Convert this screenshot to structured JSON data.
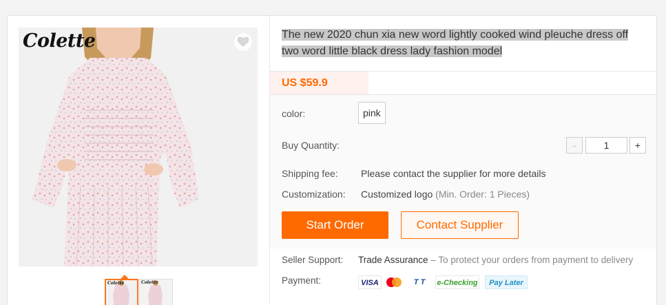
{
  "gallery": {
    "brand": "Colette",
    "thumb_brand": "Colette"
  },
  "product": {
    "title": "The new 2020 chun xia new word lightly cooked wind pleuche dress off two word little black dress lady fashion model",
    "price": "US $59.9"
  },
  "attributes": {
    "color_label": "color:",
    "color_value": "pink",
    "quantity_label": "Buy Quantity:",
    "quantity_value": "1",
    "minus": "-",
    "plus": "+",
    "shipping_label": "Shipping fee:",
    "shipping_value": "Please contact the supplier for more details",
    "customization_label": "Customization:",
    "customization_value": "Customized logo",
    "customization_note": "(Min. Order: 1 Pieces)"
  },
  "actions": {
    "start_order": "Start Order",
    "contact_supplier": "Contact Supplier"
  },
  "support": {
    "seller_support_label": "Seller Support:",
    "trade_assurance": "Trade Assurance",
    "trade_assurance_note": "– To protect your orders from payment to delivery",
    "payment_label": "Payment:",
    "methods": {
      "visa": "VISA",
      "tt": "T T",
      "echecking": "e-Checking",
      "paylater": "Pay Later"
    },
    "method_icons": [
      "visa-icon",
      "mastercard-icon",
      "tt-icon",
      "e-checking-icon",
      "pay-later-icon"
    ]
  },
  "colors": {
    "accent": "#ff6a00",
    "price_bg": "#fff1ee",
    "title_highlight": "#c8c8c8"
  }
}
